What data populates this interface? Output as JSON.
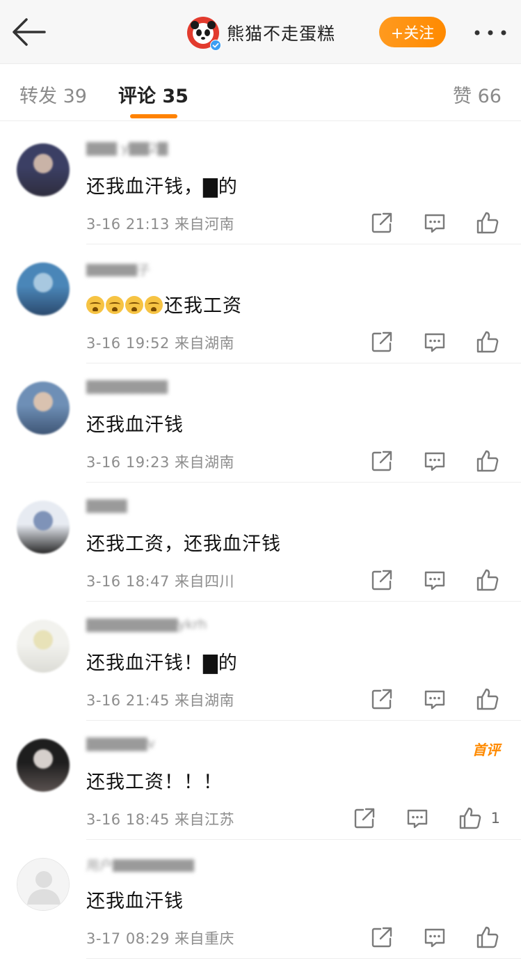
{
  "header": {
    "account_name": "熊猫不走蛋糕",
    "follow_label": "+关注"
  },
  "tabs": {
    "repost": "转发 39",
    "comment": "评论 35",
    "like": "赞 66"
  },
  "comments": [
    {
      "username": "▇▇▇ y▇▇2▇",
      "text": "还我血汗钱，▇的",
      "meta": "3-16 21:13 来自河南",
      "likes": "",
      "first": "",
      "avatar_colors": [
        "#3b3f64",
        "#c9b3a7",
        "#2e2d3e"
      ]
    },
    {
      "username": "▇▇▇▇▇子",
      "text": "还我工资",
      "emoji_count": 4,
      "meta": "3-16 19:52 来自湖南",
      "likes": "",
      "first": "",
      "avatar_colors": [
        "#4a86b8",
        "#a8c8e0",
        "#2b4a6e"
      ]
    },
    {
      "username": "▇▇▇▇▇▇▇▇",
      "text": "还我血汗钱",
      "meta": "3-16 19:23 来自湖南",
      "likes": "",
      "first": "",
      "avatar_colors": [
        "#6e8fb6",
        "#d9c2b0",
        "#3f5676"
      ]
    },
    {
      "username": "▇▇▇▇",
      "text": "还我工资，还我血汗钱",
      "meta": "3-16 18:47 来自四川",
      "likes": "",
      "first": "",
      "avatar_colors": [
        "#e7ebf2",
        "#7f93b8",
        "#2a2a2a"
      ]
    },
    {
      "username": "▇▇▇▇▇▇▇▇▇ykrh",
      "text": "还我血汗钱！▇的",
      "meta": "3-16 21:45 来自湖南",
      "likes": "",
      "first": "",
      "avatar_colors": [
        "#f2f2ee",
        "#e8e2b8",
        "#dcdcd6"
      ]
    },
    {
      "username": "▇▇▇▇▇▇v",
      "text": "还我工资！！！",
      "meta": "3-16 18:45 来自江苏",
      "likes": "1",
      "first": "首评",
      "avatar_colors": [
        "#1e1e1e",
        "#d6d0cc",
        "#5a5250"
      ]
    },
    {
      "username": "用户▇▇▇▇▇▇▇▇",
      "text": "还我血汗钱",
      "meta": "3-17 08:29 来自重庆",
      "likes": "",
      "first": "",
      "avatar_colors": [
        "#f0f0f0",
        "#dcdcdc",
        "#ffffff"
      ]
    }
  ],
  "colors": {
    "accent": "#ff8200",
    "follow_bg": "#ff8a00",
    "text_meta": "#8d8d8d"
  },
  "icons": [
    "back-arrow-icon",
    "panda-avatar-icon",
    "verified-icon",
    "more-icon",
    "share-icon",
    "comment-icon",
    "like-icon"
  ]
}
